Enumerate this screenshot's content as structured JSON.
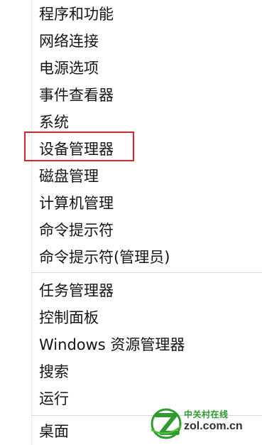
{
  "menu": {
    "items": [
      {
        "label": "程序和功能"
      },
      {
        "label": "网络连接"
      },
      {
        "label": "电源选项"
      },
      {
        "label": "事件查看器"
      },
      {
        "label": "系统"
      },
      {
        "label": "设备管理器"
      },
      {
        "label": "磁盘管理"
      },
      {
        "label": "计算机管理"
      },
      {
        "label": "命令提示符"
      },
      {
        "label": "命令提示符(管理员)"
      },
      {
        "label": "任务管理器"
      },
      {
        "label": "控制面板"
      },
      {
        "label": "Windows 资源管理器"
      },
      {
        "label": "搜索"
      },
      {
        "label": "运行"
      },
      {
        "label": "桌面"
      }
    ],
    "highlighted_item": "设备管理器",
    "highlight_color": "#e0202a"
  },
  "watermark": {
    "line1": "中关村在线",
    "line2": "zol.com.cn",
    "logo_icon": "zol-logo-icon",
    "brand_color": "#2e9a2f"
  }
}
